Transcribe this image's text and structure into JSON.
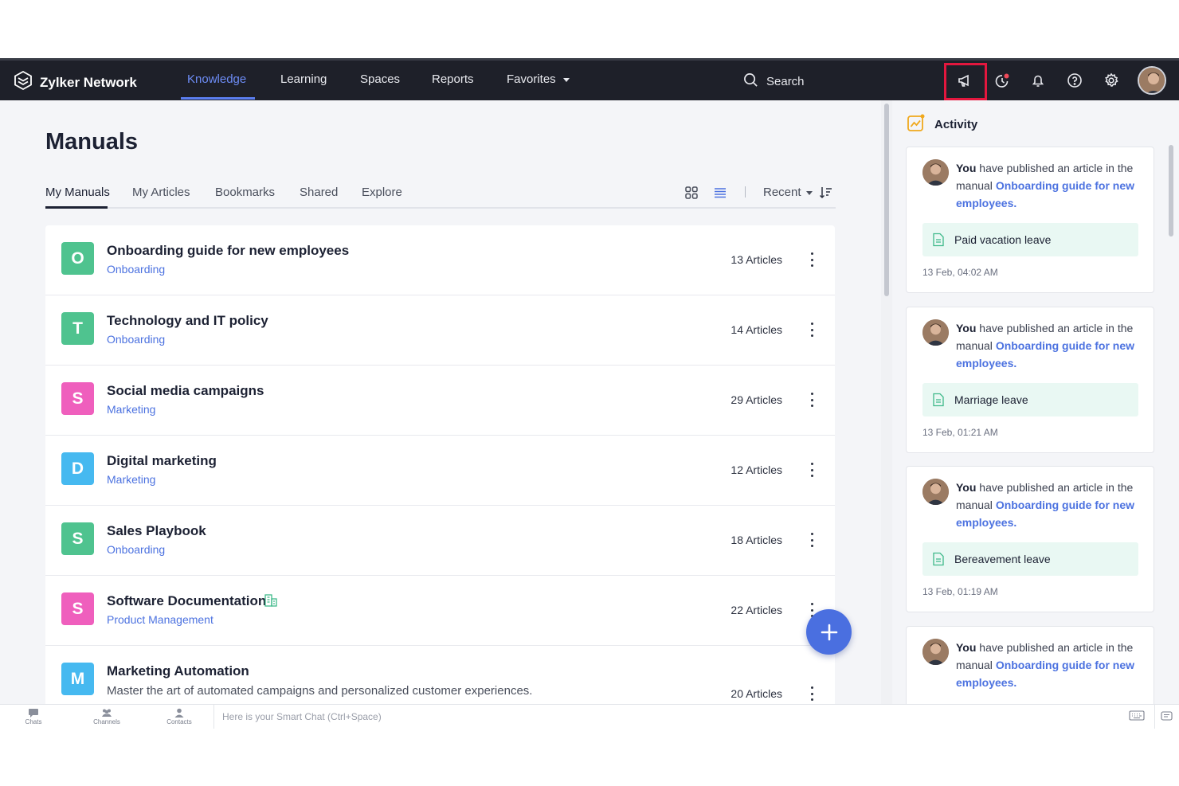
{
  "app": {
    "brand": "Zylker Network"
  },
  "nav": {
    "links": [
      "Knowledge",
      "Learning",
      "Spaces",
      "Reports",
      "Favorites"
    ],
    "active": "Knowledge",
    "search_placeholder": "Search",
    "icons": [
      "announcement-icon",
      "activity-clock-icon",
      "bell-icon",
      "help-icon",
      "gear-icon",
      "avatar"
    ]
  },
  "page": {
    "title": "Manuals",
    "tabs": [
      "My Manuals",
      "My Articles",
      "Bookmarks",
      "Shared",
      "Explore"
    ],
    "active_tab": "My Manuals",
    "sort_label": "Recent"
  },
  "manuals": [
    {
      "letter": "O",
      "color": "#4fc38f",
      "title": "Onboarding guide for new employees",
      "category": "Onboarding",
      "count": "13 Articles"
    },
    {
      "letter": "T",
      "color": "#4fc38f",
      "title": "Technology and IT policy",
      "category": "Onboarding",
      "count": "14 Articles"
    },
    {
      "letter": "S",
      "color": "#ef5fbd",
      "title": "Social media campaigns",
      "category": "Marketing",
      "count": "29 Articles"
    },
    {
      "letter": "D",
      "color": "#46b9f0",
      "title": "Digital marketing",
      "category": "Marketing",
      "count": "12 Articles"
    },
    {
      "letter": "S",
      "color": "#4fc38f",
      "title": "Sales Playbook",
      "category": "Onboarding",
      "count": "18 Articles"
    },
    {
      "letter": "S",
      "color": "#ef5fbd",
      "title": "Software Documentation",
      "category": "Product Management",
      "count": "22 Articles"
    },
    {
      "letter": "M",
      "color": "#46b9f0",
      "title": "Marketing Automation",
      "description": "Master the art of automated campaigns and personalized customer experiences.",
      "count": "20 Articles"
    }
  ],
  "activity": {
    "title": "Activity",
    "items": [
      {
        "actor": "You",
        "text": " have published an article in the manual ",
        "manual": "Onboarding guide for new employees.",
        "article": "Paid vacation leave",
        "time": "13 Feb, 04:02 AM"
      },
      {
        "actor": "You",
        "text": " have published an article in the manual ",
        "manual": "Onboarding guide for new employees.",
        "article": "Marriage leave",
        "time": "13 Feb, 01:21 AM"
      },
      {
        "actor": "You",
        "text": " have published an article in the manual ",
        "manual": "Onboarding guide for new employees.",
        "article": "Bereavement leave",
        "time": "13 Feb, 01:19 AM"
      },
      {
        "actor": "You",
        "text": " have published an article in the manual ",
        "manual": "Onboarding guide for new employees.",
        "article": "",
        "time": ""
      }
    ]
  },
  "bottom": {
    "items": [
      "Chats",
      "Channels",
      "Contacts"
    ],
    "smart_chat": "Here is your Smart Chat (Ctrl+Space)"
  },
  "colors": {
    "navbar": "#1e2029",
    "accent": "#4c72e0",
    "highlight": "#e3173e"
  }
}
